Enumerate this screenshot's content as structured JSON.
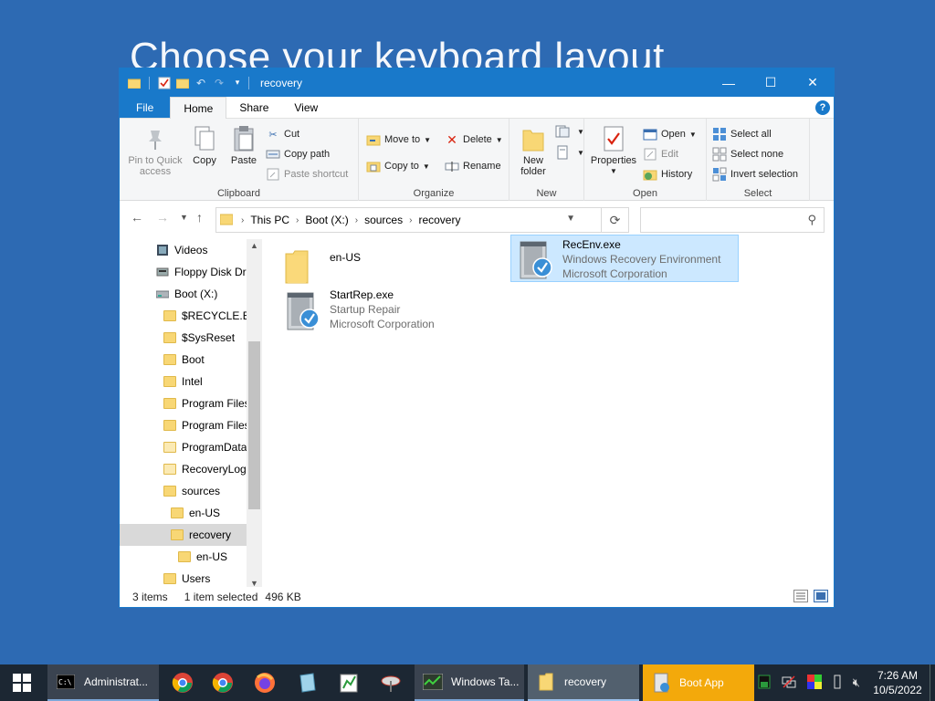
{
  "background": {
    "title": "Choose your keyboard layout"
  },
  "window": {
    "title": "recovery",
    "accent": "#1979ca",
    "controls": {
      "minimize": "—",
      "maximize": "☐",
      "close": "✕"
    }
  },
  "ribbon_tabs": [
    "File",
    "Home",
    "Share",
    "View"
  ],
  "help": "?",
  "ribbon": {
    "clipboard": {
      "label": "Clipboard",
      "pin": "Pin to Quick access",
      "copy": "Copy",
      "paste": "Paste",
      "cut": "Cut",
      "copy_path": "Copy path",
      "paste_shortcut": "Paste shortcut"
    },
    "organize": {
      "label": "Organize",
      "move_to": "Move to",
      "copy_to": "Copy to",
      "delete": "Delete",
      "rename": "Rename"
    },
    "new": {
      "label": "New",
      "new_folder": "New folder"
    },
    "open": {
      "label": "Open",
      "properties": "Properties",
      "open": "Open",
      "edit": "Edit",
      "history": "History"
    },
    "select": {
      "label": "Select",
      "select_all": "Select all",
      "select_none": "Select none",
      "invert": "Invert selection"
    }
  },
  "address": {
    "crumbs": [
      "This PC",
      "Boot (X:)",
      "sources",
      "recovery"
    ],
    "search_placeholder": ""
  },
  "nav_pane": {
    "items": [
      {
        "label": "Videos",
        "icon": "videos-icon"
      },
      {
        "label": "Floppy Disk Dri",
        "icon": "floppy-icon"
      },
      {
        "label": "Boot (X:)",
        "icon": "drive-icon"
      },
      {
        "label": "$RECYCLE.BIN",
        "icon": "folder-icon"
      },
      {
        "label": "$SysReset",
        "icon": "folder-icon"
      },
      {
        "label": "Boot",
        "icon": "folder-icon"
      },
      {
        "label": "Intel",
        "icon": "folder-icon"
      },
      {
        "label": "Program Files",
        "icon": "folder-icon"
      },
      {
        "label": "Program Files",
        "icon": "folder-icon"
      },
      {
        "label": "ProgramData",
        "icon": "folder-icon"
      },
      {
        "label": "RecoveryLogs",
        "icon": "folder-icon"
      },
      {
        "label": "sources",
        "icon": "folder-icon"
      },
      {
        "label": "en-US",
        "icon": "folder-icon"
      },
      {
        "label": "recovery",
        "icon": "folder-icon",
        "selected": true
      },
      {
        "label": "en-US",
        "icon": "folder-icon"
      },
      {
        "label": "Users",
        "icon": "folder-icon"
      }
    ]
  },
  "files": [
    {
      "name": "en-US",
      "type": "folder"
    },
    {
      "name": "RecEnv.exe",
      "line2": "Windows Recovery Environment",
      "line3": "Microsoft Corporation",
      "selected": true
    },
    {
      "name": "StartRep.exe",
      "line2": "Startup Repair",
      "line3": "Microsoft Corporation"
    }
  ],
  "status": {
    "count": "3 items",
    "selection": "1 item selected",
    "size": "496 KB"
  },
  "taskbar": {
    "items": [
      {
        "label": "Administrat...",
        "icon": "cmd-icon"
      },
      {
        "label": "Windows Ta...",
        "icon": "task-manager-icon"
      },
      {
        "label": "recovery",
        "icon": "folder-icon"
      },
      {
        "label": "Boot App",
        "icon": "boot-app-icon"
      }
    ],
    "clock_time": "7:26 AM",
    "clock_date": "10/5/2022"
  }
}
